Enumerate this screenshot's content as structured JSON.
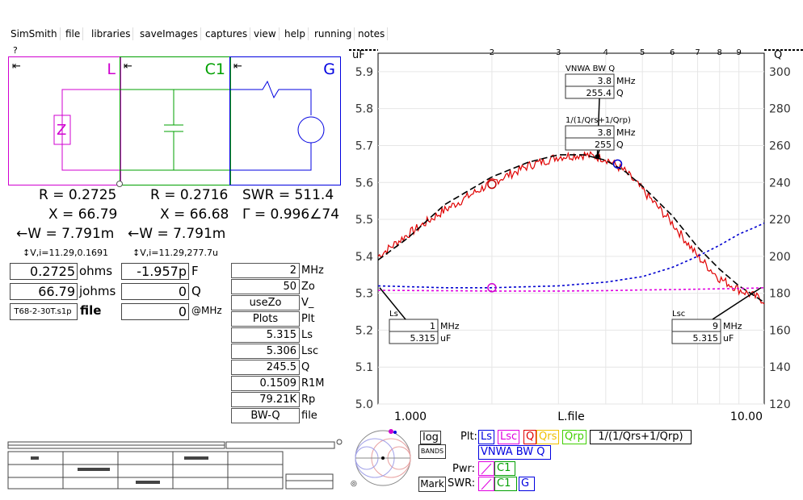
{
  "menu": [
    "SimSmith",
    "file",
    "libraries",
    "saveImages",
    "captures",
    "view",
    "help",
    "running",
    "notes"
  ],
  "question": "?",
  "components": [
    {
      "name": "L",
      "color": "#d000d0",
      "R": "R = 0.2725",
      "X": "X = 66.79",
      "W": "←W = 7.791m",
      "VI": "↕V,i=11.29,0.1691"
    },
    {
      "name": "C1",
      "color": "#00a000",
      "R": "R = 0.2716",
      "X": "X = 66.68",
      "W": "←W = 7.791m",
      "VI": "↕V,i=11.29,277.7u"
    },
    {
      "name": "G",
      "color": "#0000e0",
      "R": "SWR = 511.4",
      "X": "Γ = 0.996∠74",
      "W": "",
      "VI": ""
    }
  ],
  "arrow": "⇤",
  "fields_left": [
    {
      "value": "0.2725",
      "label": "ohms"
    },
    {
      "value": "66.79",
      "label": "johms"
    },
    {
      "value": "T68-2-30T.s1p",
      "label": "file"
    }
  ],
  "fields_mid": [
    {
      "value": "-1.957p",
      "label": "F"
    },
    {
      "value": "0",
      "label": "Q"
    },
    {
      "value": "0",
      "label": "@MHz"
    }
  ],
  "table": [
    {
      "value": "2",
      "label": "MHz",
      "center": false
    },
    {
      "value": "50",
      "label": "Zo",
      "center": false
    },
    {
      "value": "useZo",
      "label": "V_",
      "center": true
    },
    {
      "value": "Plots",
      "label": "Plt",
      "center": true
    },
    {
      "value": "5.315",
      "label": "Ls",
      "center": false
    },
    {
      "value": "5.306",
      "label": "Lsc",
      "center": false
    },
    {
      "value": "245.5",
      "label": "Q",
      "center": false
    },
    {
      "value": "0.1509",
      "label": "R1M",
      "center": false
    },
    {
      "value": "79.21K",
      "label": "Rp",
      "center": false
    },
    {
      "value": "BW-Q",
      "label": "file",
      "center": true
    }
  ],
  "chart_data": {
    "type": "line",
    "left_axis_label": "uF",
    "right_axis_label": "Q",
    "x_axis_label": "L.file",
    "x_scale": "log",
    "x_range": [
      1,
      10.5
    ],
    "x_end_labels": [
      "1.000",
      "10.00"
    ],
    "x_ticks": [
      2,
      3,
      4,
      5,
      6,
      7,
      8,
      9
    ],
    "y_left_range": [
      5.0,
      5.95
    ],
    "y_left_ticks": [
      "5.0",
      "5.1",
      "5.2",
      "5.3",
      "5.4",
      "5.5",
      "5.6",
      "5.7",
      "5.8",
      "5.9"
    ],
    "y_right_range": [
      120,
      310
    ],
    "y_right_ticks": [
      "120",
      "140",
      "160",
      "180",
      "200",
      "220",
      "240",
      "260",
      "280",
      "300"
    ],
    "series": [
      {
        "name": "VNWA BW Q",
        "color": "#e00000",
        "style": "noisy",
        "axis": "right",
        "x": [
          1,
          1.2,
          1.5,
          2,
          2.5,
          3,
          3.5,
          4,
          4.5,
          5,
          6,
          7,
          8,
          9,
          10,
          10.5
        ],
        "y": [
          200,
          212,
          225,
          240,
          249,
          254,
          255,
          253,
          246,
          236,
          218,
          200,
          188,
          182,
          178,
          176
        ]
      },
      {
        "name": "1/(1/Qrs+1/Qrp)",
        "color": "#000000",
        "style": "dashed",
        "axis": "right",
        "x": [
          1,
          1.2,
          1.5,
          2,
          2.5,
          3,
          3.5,
          4,
          4.5,
          5,
          6,
          7,
          8,
          9,
          10,
          10.5
        ],
        "y": [
          198,
          210,
          228,
          243,
          251,
          255,
          255,
          252,
          246,
          238,
          222,
          205,
          193,
          184,
          178,
          175
        ]
      },
      {
        "name": "Ls",
        "color": "#0000d0",
        "style": "dotted",
        "axis": "left",
        "x": [
          1,
          1.5,
          2,
          3,
          4,
          5,
          6,
          7,
          8,
          9,
          10,
          10.5
        ],
        "y": [
          5.32,
          5.315,
          5.315,
          5.32,
          5.33,
          5.345,
          5.37,
          5.4,
          5.43,
          5.46,
          5.48,
          5.49
        ]
      },
      {
        "name": "Lsc",
        "color": "#e000e0",
        "style": "dotted",
        "axis": "left",
        "x": [
          1,
          2,
          3,
          4,
          5,
          6,
          7,
          8,
          9,
          10,
          10.5
        ],
        "y": [
          5.308,
          5.306,
          5.306,
          5.307,
          5.309,
          5.31,
          5.311,
          5.312,
          5.313,
          5.314,
          5.315
        ]
      }
    ],
    "markers": [
      {
        "title": "VNWA BW Q",
        "line1_value": "3.8",
        "line1_unit": "MHz",
        "line2_value": "255.4",
        "line2_unit": "Q"
      },
      {
        "title": "1/(1/Qrs+1/Qrp)",
        "line1_value": "3.8",
        "line1_unit": "MHz",
        "line2_value": "255",
        "line2_unit": "Q"
      },
      {
        "title": "Ls",
        "line1_value": "1",
        "line1_unit": "MHz",
        "line2_value": "5.315",
        "line2_unit": "uF"
      },
      {
        "title": "Lsc",
        "line1_value": "9",
        "line1_unit": "MHz",
        "line2_value": "5.315",
        "line2_unit": "uF"
      }
    ]
  },
  "bottom": {
    "log_label": "log",
    "bands_label": "BANDS",
    "mark_label": "Mark",
    "plt_label": "Plt:",
    "pwr_label": "Pwr:",
    "swr_label": "SWR:",
    "legend": [
      {
        "text": "Ls",
        "color": "#0000e0"
      },
      {
        "text": "Lsc",
        "color": "#e000e0"
      },
      {
        "text": "Q",
        "color": "#e00000"
      },
      {
        "text": "Qrs",
        "color": "#f0c000"
      },
      {
        "text": "Qrp",
        "color": "#40d000"
      },
      {
        "text": "1/(1/Qrs+1/Qrp)",
        "color": "#000000"
      }
    ],
    "vnwa_label": "VNWA BW Q",
    "pwr_boxes": [
      "",
      "C1"
    ],
    "swr_boxes": [
      "",
      "C1",
      "G"
    ]
  }
}
